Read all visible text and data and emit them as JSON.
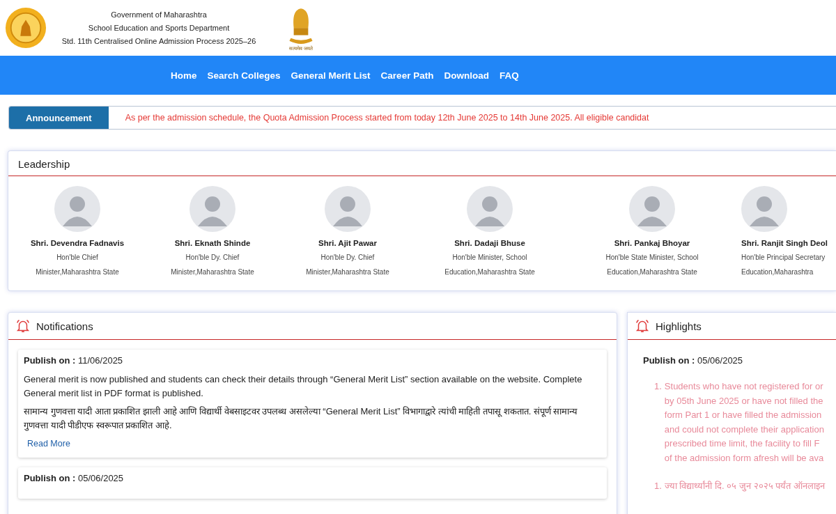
{
  "header": {
    "lines": [
      "Government of Maharashtra",
      "School Education and Sports Department",
      "Std. 11th Centralised Online Admission Process 2025–26"
    ],
    "emblem_motto": "सत्यमेव जयते"
  },
  "nav": [
    "Home",
    "Search Colleges",
    "General Merit List",
    "Career Path",
    "Download",
    "FAQ"
  ],
  "announcement": {
    "label": "Announcement",
    "text": "As per the admission schedule, the Quota Admission Process started from today 12th June 2025 to 14th June 2025. All eligible candidat"
  },
  "leadership": {
    "title": "Leadership",
    "people": [
      {
        "name": "Shri. Devendra Fadnavis",
        "role": [
          "Hon'ble Chief",
          "Minister,Maharashtra State"
        ]
      },
      {
        "name": "Shri. Eknath Shinde",
        "role": [
          "Hon'ble Dy. Chief",
          "Minister,Maharashtra State"
        ]
      },
      {
        "name": "Shri. Ajit Pawar",
        "role": [
          "Hon'ble Dy. Chief",
          "Minister,Maharashtra State"
        ]
      },
      {
        "name": "Shri. Dadaji Bhuse",
        "role": [
          "Hon'ble Minister, School",
          "Education,Maharashtra State"
        ]
      },
      {
        "name": "Shri. Pankaj Bhoyar",
        "role": [
          "Hon'ble State Minister, School",
          "Education,Maharashtra State"
        ]
      },
      {
        "name": "Shri. Ranjit Singh Deol",
        "role": [
          "Hon'ble Principal Secretary",
          "Education,Maharashtra"
        ]
      }
    ]
  },
  "notifications": {
    "title": "Notifications",
    "items": [
      {
        "publish_label": "Publish on :",
        "date": "11/06/2025",
        "paragraphs": [
          "General merit is now published and students can check their details through “General Merit List” section available on the website. Complete General merit list in PDF format is published.",
          "सामान्य गुणवत्ता यादी आता प्रकाशित झाली आहे आणि विद्यार्थी वेबसाइटवर उपलब्ध असलेल्या “General Merit List” विभागाद्वारे त्यांची माहिती तपासू शकतात. संपूर्ण सामान्य गुणवत्ता यादी पीडीएफ स्वरूपात प्रकाशित आहे."
        ],
        "link": "Read More"
      },
      {
        "publish_label": "Publish on :",
        "date": "05/06/2025"
      }
    ]
  },
  "highlights": {
    "title": "Highlights",
    "publish_label": "Publish on :",
    "date": "05/06/2025",
    "items": [
      {
        "number": "1.",
        "lines": [
          "Students who have not registered for or",
          "by 05th June 2025 or have not filled the",
          "form Part 1 or have filled the admission",
          "and could not complete their application",
          "prescribed time limit, the facility to fill F",
          "of the admission form afresh will be ava"
        ]
      },
      {
        "number": "1.",
        "lines": [
          "ज्या विद्यार्थ्यांनी दि. ०५ जुन २०२५ पर्यंत ऑनलाइन"
        ]
      }
    ]
  }
}
